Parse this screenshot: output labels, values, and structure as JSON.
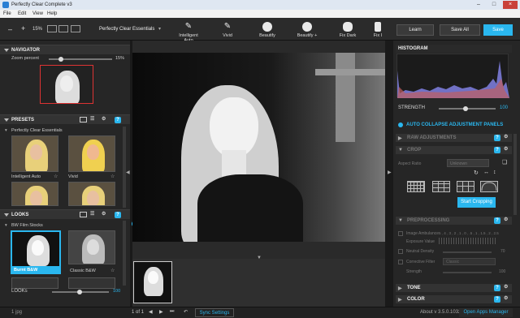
{
  "window": {
    "title": "Perfectly Clear Complete v3"
  },
  "menu": [
    "File",
    "Edit",
    "View",
    "Help"
  ],
  "toolbar": {
    "zoom": "15%",
    "preset_name": "Perfectly Clear Essentials",
    "presets": [
      "Intelligent Auto",
      "Vivid",
      "Beautify",
      "Beautify +",
      "Fix Dark",
      "Fix I"
    ],
    "learn": "Learn",
    "save_all": "Save All",
    "save": "Save"
  },
  "navigator": {
    "title": "NAVIGATOR",
    "zoom_label": "Zoom percent",
    "zoom_value": "15%"
  },
  "presets": {
    "title": "PRESETS",
    "group": "Perfectly Clear Essentials",
    "items": [
      "Intelligent Auto",
      "Vivid"
    ]
  },
  "looks": {
    "title": "LOOKS",
    "group": "BW Film Stocks",
    "items": [
      "Burnt B&W",
      "Classic B&W"
    ],
    "strength_label": "LOOKs",
    "strength_value": "100"
  },
  "filmstrip": {
    "count": "1 of 1",
    "sync": "Sync Settings"
  },
  "right": {
    "histogram": "HISTOGRAM",
    "strength_label": "STRENGTH",
    "strength_value": "100",
    "auto_collapse": "AUTO COLLAPSE ADJUSTMENT PANELS",
    "raw": "RAW ADJUSTMENTS",
    "crop": "CROP",
    "aspect_label": "Aspect Ratio",
    "aspect_value": "Unknown",
    "start_cropping": "Start Cropping",
    "preprocessing": "PREPROCESSING",
    "image_ambulance": "Image Ambulance",
    "ambulance_scale": "5 , 4 , 3 , 2 , 1 , 0 , .5 , 1 , 1.5 , 2 , 2.5",
    "exposure_value": "Exposure Value",
    "neutral_density": "Neutral Density",
    "neutral_value": "70",
    "corrective_filter": "Corrective Filter",
    "corrective_value": "Classic",
    "strength2": "Strength",
    "strength2_value": "100",
    "tone": "TONE",
    "color": "COLOR"
  },
  "status": {
    "left": "1 jpg",
    "version": "About v 3.5.0.1032",
    "open_apps": "Open Apps Manager"
  },
  "colors": {
    "accent": "#2ab7ef",
    "panel": "#262626",
    "toolbar": "#2b2b2b"
  }
}
